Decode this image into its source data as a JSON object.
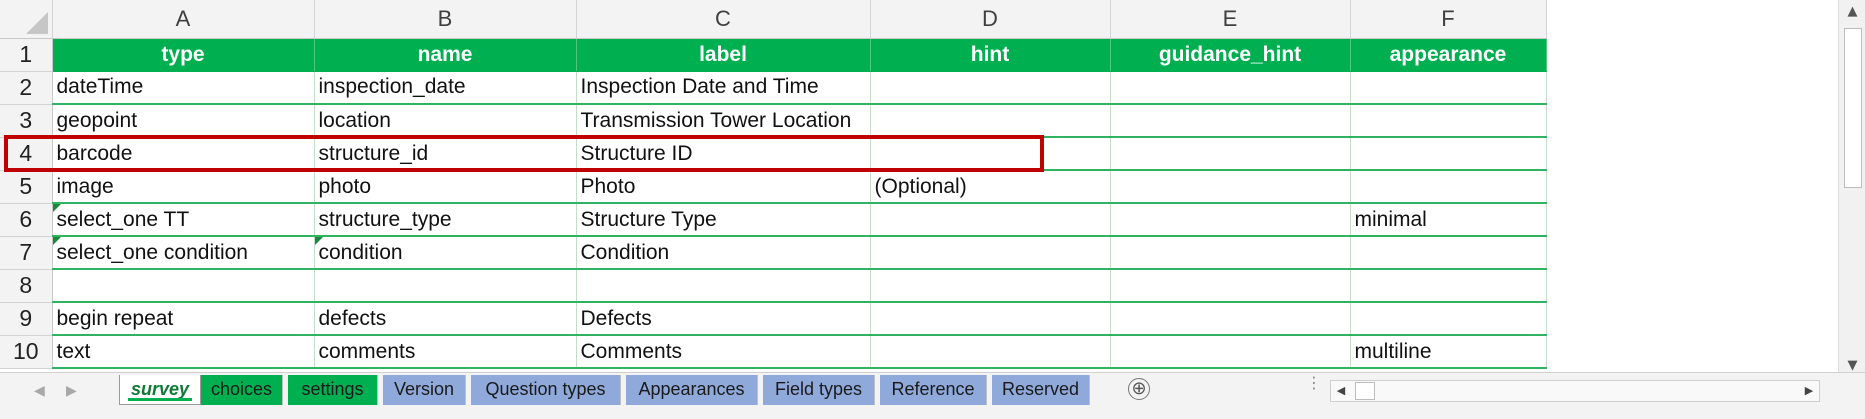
{
  "column_headers": [
    "A",
    "B",
    "C",
    "D",
    "E",
    "F"
  ],
  "row_numbers": [
    "1",
    "2",
    "3",
    "4",
    "5",
    "6",
    "7",
    "8",
    "9",
    "10"
  ],
  "header_row": [
    "type",
    "name",
    "label",
    "hint",
    "guidance_hint",
    "appearance"
  ],
  "rows": [
    [
      "dateTime",
      "inspection_date",
      "Inspection Date and Time",
      "",
      "",
      ""
    ],
    [
      "geopoint",
      "location",
      "Transmission Tower Location",
      "",
      "",
      ""
    ],
    [
      "barcode",
      "structure_id",
      "Structure ID",
      "",
      "",
      ""
    ],
    [
      "image",
      "photo",
      "Photo",
      "(Optional)",
      "",
      ""
    ],
    [
      "select_one TT",
      "structure_type",
      "Structure Type",
      "",
      "",
      "minimal"
    ],
    [
      "select_one condition",
      "condition",
      "Condition",
      "",
      "",
      ""
    ],
    [
      "",
      "",
      "",
      "",
      "",
      ""
    ],
    [
      "begin repeat",
      "defects",
      "Defects",
      "",
      "",
      ""
    ],
    [
      "text",
      "comments",
      "Comments",
      "",
      "",
      "multiline"
    ]
  ],
  "sheet_tabs": [
    {
      "label": "survey",
      "color": "#00b050",
      "active": true
    },
    {
      "label": "choices",
      "color": "#00b050",
      "active": false
    },
    {
      "label": "settings",
      "color": "#00b050",
      "active": false
    },
    {
      "label": "Version",
      "color": "#8fa9db",
      "active": false
    },
    {
      "label": "Question types",
      "color": "#8fa9db",
      "active": false
    },
    {
      "label": "Appearances",
      "color": "#8fa9db",
      "active": false
    },
    {
      "label": "Field types",
      "color": "#8fa9db",
      "active": false
    },
    {
      "label": "Reference",
      "color": "#8fa9db",
      "active": false
    },
    {
      "label": "Reserved",
      "color": "#8fa9db",
      "active": false
    }
  ],
  "icons": {
    "add_sheet": "⊕",
    "scroll_left": "◀",
    "scroll_right": "▶",
    "scroll_up": "▲",
    "scroll_down": "▼",
    "tab_prev": "◀",
    "tab_next": "▶",
    "split": "⋮"
  },
  "colors": {
    "header_fill": "#00b050",
    "highlight_border": "#c00000",
    "reference_tab": "#8fa9db"
  }
}
